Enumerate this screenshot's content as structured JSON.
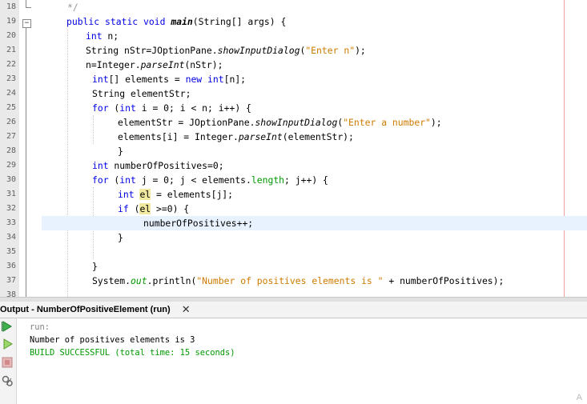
{
  "editor": {
    "line_numbers": [
      "18",
      "19",
      "20",
      "21",
      "22",
      "23",
      "24",
      "25",
      "26",
      "27",
      "28",
      "29",
      "30",
      "31",
      "32",
      "33",
      "34",
      "35",
      "36",
      "37",
      "38"
    ],
    "fold_toggle": "−"
  },
  "output": {
    "tab_title": "Output - NumberOfPositiveElement (run)",
    "close_glyph": "✕",
    "lines": [
      "run:",
      "Number of positives elements is 3",
      "BUILD SUCCESSFUL (total time: 15 seconds)"
    ],
    "colors": {
      "run": "#808080",
      "normal": "#000000",
      "success": "#009900"
    },
    "corner_glyph": "A"
  },
  "code": {
    "l18_comment": "*/",
    "l19_kw1": "public",
    "l19_kw2": "static",
    "l19_kw3": "void",
    "l19_method": "main",
    "l19_rest": "(String[] args) {",
    "l20_kw": "int",
    "l20_rest": " n;",
    "l21_a": "String nStr=JOptionPane.",
    "l21_method": "showInputDialog",
    "l21_b": "(",
    "l21_str": "\"Enter n\"",
    "l21_c": ");",
    "l22_a": "n=Integer.",
    "l22_method": "parseInt",
    "l22_b": "(nStr);",
    "l23_kw": "int",
    "l23_a": "[] elements = ",
    "l23_kw2": "new",
    "l23_kw3": "int",
    "l23_b": "[n];",
    "l24": "String elementStr;",
    "l25_kw": "for",
    "l25_a": " (",
    "l25_kw2": "int",
    "l25_b": " i = 0; i < n; i++) {",
    "l26_a": "elementStr = JOptionPane.",
    "l26_method": "showInputDialog",
    "l26_b": "(",
    "l26_str": "\"Enter a number\"",
    "l26_c": ");",
    "l27_a": "elements[i] = Integer.",
    "l27_method": "parseInt",
    "l27_b": "(elementStr);",
    "l28": "}",
    "l29_kw": "int",
    "l29_rest": " numberOfPositives=0;",
    "l30_kw": "for",
    "l30_a": " (",
    "l30_kw2": "int",
    "l30_b": " j = 0; j < elements.",
    "l30_fld": "length",
    "l30_c": "; j++) {",
    "l31_kw": "int",
    "l31_a": " ",
    "l31_var": "el",
    "l31_b": " = elements[j];",
    "l32_kw": "if",
    "l32_a": " (",
    "l32_var": "el",
    "l32_b": " >=0) {",
    "l33": "numberOfPositives++;",
    "l34": "}",
    "l36": "}",
    "l37_a": "System.",
    "l37_fld": "out",
    "l37_b": ".println(",
    "l37_str": "\"Number of positives elements is \"",
    "l37_c": " + numberOfPositives);"
  }
}
